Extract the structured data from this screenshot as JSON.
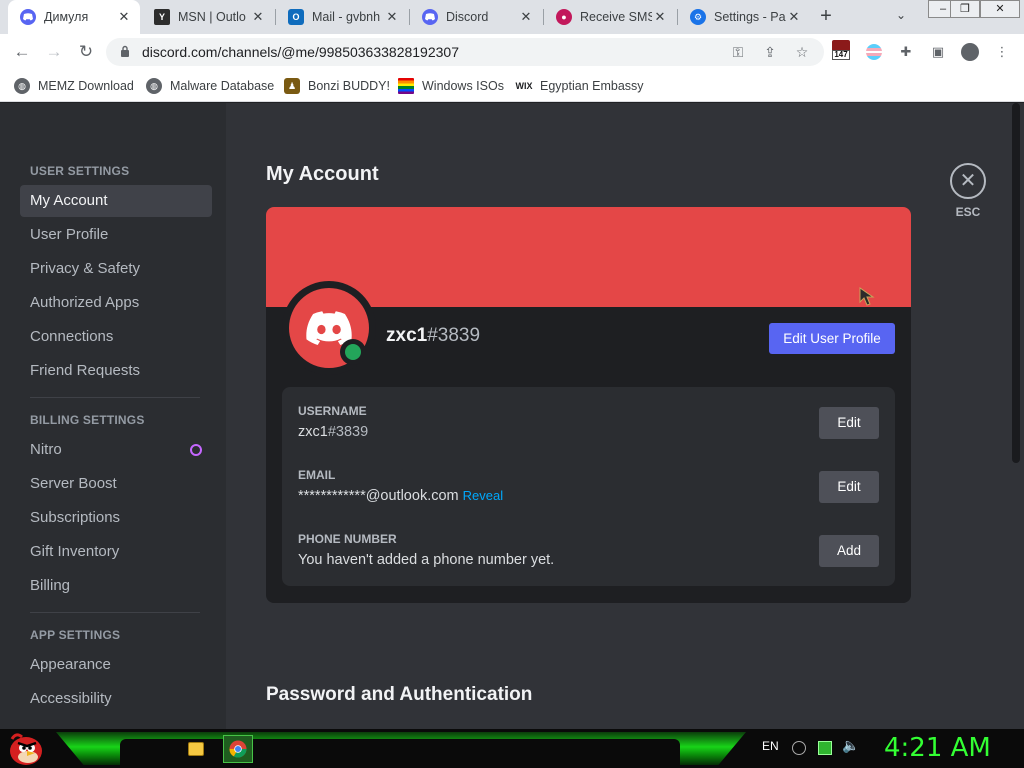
{
  "browser": {
    "tabs": [
      {
        "title": "Димуля",
        "icon": "discord-icon",
        "color": "#5865f2",
        "active": true
      },
      {
        "title": "MSN | Outlo",
        "icon": "yahoo-icon",
        "color": "#2d2d2d",
        "active": false
      },
      {
        "title": "Mail - gvbnh",
        "icon": "outlook-icon",
        "color": "#0f6cbd",
        "active": false
      },
      {
        "title": "Discord",
        "icon": "discord-icon",
        "color": "#5865f2",
        "active": false
      },
      {
        "title": "Receive SMS",
        "icon": "receive-sms-icon",
        "color": "#c2185b",
        "active": false
      },
      {
        "title": "Settings - Pa",
        "icon": "settings-gear-icon",
        "color": "#1a73e8",
        "active": false
      }
    ],
    "url": "discord.com/channels/@me/998503633828192307",
    "extension_badge": "147",
    "bookmarks": [
      {
        "label": "MEMZ Download",
        "icon": "globe-icon"
      },
      {
        "label": "Malware Database",
        "icon": "globe-icon"
      },
      {
        "label": "Bonzi BUDDY!",
        "icon": "bonzi-icon"
      },
      {
        "label": "Windows ISOs",
        "icon": "rainbow-flag-icon"
      },
      {
        "label": "Egyptian Embassy",
        "icon": "wix-icon"
      }
    ]
  },
  "settings_sidebar": {
    "user_settings_heading": "USER SETTINGS",
    "user_items": [
      "My Account",
      "User Profile",
      "Privacy & Safety",
      "Authorized Apps",
      "Connections",
      "Friend Requests"
    ],
    "billing_heading": "BILLING SETTINGS",
    "billing_items": [
      "Nitro",
      "Server Boost",
      "Subscriptions",
      "Gift Inventory",
      "Billing"
    ],
    "app_heading": "APP SETTINGS",
    "app_items": [
      "Appearance",
      "Accessibility"
    ],
    "active_item": "My Account"
  },
  "account": {
    "page_title": "My Account",
    "banner_color": "#e44747",
    "username": "zxc1",
    "discriminator": "#3839",
    "edit_profile_label": "Edit User Profile",
    "fields": {
      "username_label": "USERNAME",
      "username_value_name": "zxc1",
      "username_value_disc": "#3839",
      "username_button": "Edit",
      "email_label": "EMAIL",
      "email_value": "************@outlook.com",
      "email_reveal": "Reveal",
      "email_button": "Edit",
      "phone_label": "PHONE NUMBER",
      "phone_value": "You haven't added a phone number yet.",
      "phone_button": "Add"
    },
    "password_section_title": "Password and Authentication",
    "esc_label": "ESC"
  },
  "taskbar": {
    "language": "EN",
    "clock": "4:21 AM",
    "accent_color": "#33ff33"
  }
}
